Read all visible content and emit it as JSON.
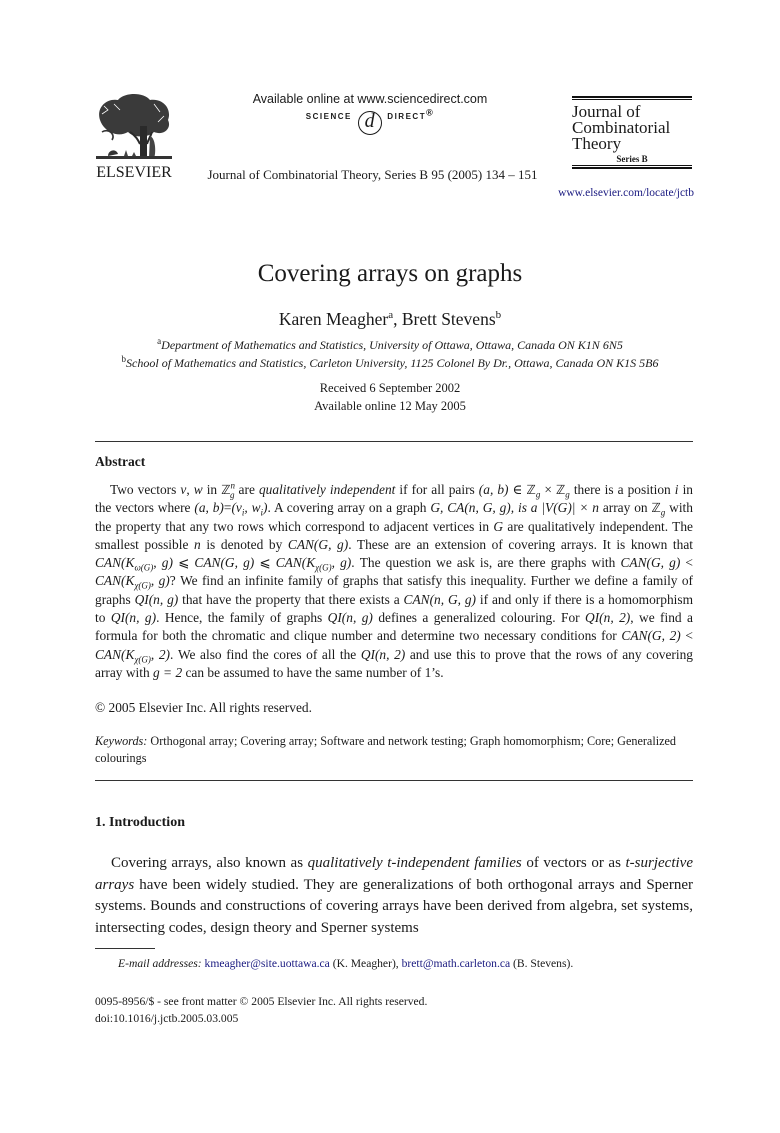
{
  "header": {
    "publisher": "ELSEVIER",
    "sciencedirect_available": "Available online at www.sciencedirect.com",
    "sciencedirect_logo_left": "SCIENCE",
    "sciencedirect_logo_at": "d",
    "sciencedirect_logo_right": "DIRECT",
    "sciencedirect_logo_mark": "®",
    "journal_citation": "Journal of Combinatorial Theory, Series B 95 (2005) 134 – 151",
    "journal_box": {
      "line1": "Journal of",
      "line2": "Combinatorial",
      "line3": "Theory",
      "series": "Series B"
    },
    "journal_url": "www.elsevier.com/locate/jctb"
  },
  "article": {
    "title": "Covering arrays on graphs",
    "authors": [
      {
        "name": "Karen Meagher",
        "mark": "a"
      },
      {
        "name": "Brett Stevens",
        "mark": "b"
      }
    ],
    "author_separator": ", ",
    "affiliations": [
      {
        "mark": "a",
        "text": "Department of Mathematics and Statistics, University of Ottawa, Ottawa, Canada ON K1N 6N5"
      },
      {
        "mark": "b",
        "text": "School of Mathematics and Statistics, Carleton University, 1125 Colonel By Dr., Ottawa, Canada ON K1S 5B6"
      }
    ],
    "received": "Received 6 September 2002",
    "available_online": "Available online 12 May 2005"
  },
  "abstract": {
    "heading": "Abstract",
    "segments": {
      "s1": "Two vectors ",
      "v": "v",
      "comma_w": ", ",
      "w": "w",
      "in": " in ",
      "Z": "ℤ",
      "g": "g",
      "n": "n",
      "are": " are ",
      "qi": "qualitatively independent",
      "iffor": " if for all pairs ",
      "ab": "(a, b)",
      "elem": " ∈ ",
      "times": " × ",
      "there": " there is a position ",
      "i": "i",
      "where": " in the vectors where ",
      "eq": "=",
      "viwi_open": "(v",
      "sub_i": "i",
      "viwi_mid": ", w",
      "viwi_close": ")",
      "acover": ". A covering array on a graph ",
      "G": "G",
      "ca": ", CA(n, G, g)",
      "isa": ", is a |V(G)| × n",
      "arrayon": " array on ",
      "prop": " with the property that any two rows which correspond to adjacent vertices in ",
      "arequal": " are qualitatively independent. The smallest possible ",
      "denoted": " is denoted by ",
      "cangg": "CAN(G, g)",
      "ext": ". These are an extension of covering arrays. It is known that ",
      "canK": "CAN(K",
      "omega": "ω(G)",
      "chi": "χ(G)",
      "comma_g": ", g)",
      "leq": " ⩽ ",
      "question": ". The question we ask is, are there graphs with ",
      "lt": " < ",
      "qmark": "? We find an infinite family of graphs that satisfy this inequality. Further we define a family of graphs ",
      "qing": "QI(n, g)",
      "haveprop": " that have the property that there exists a ",
      "canngg": "CAN(n, G, g)",
      "iff": " if and only if there is a homomorphism to ",
      "hence": ". Hence, the family of graphs ",
      "defines": " defines a generalized colouring. For ",
      "qin2": "QI(n, 2)",
      "formula": ", we find a formula for both the chromatic and clique number and determine two necessary conditions for ",
      "can2": "CAN(G, 2)",
      "comma_2": ", 2)",
      "also": ". We also find the cores of all the ",
      "use": " and use this to prove that the rows of any covering array with ",
      "g2": "g = 2",
      "same": " can be assumed to have the same number of 1’s."
    },
    "copyright": "© 2005 Elsevier Inc. All rights reserved."
  },
  "keywords": {
    "label": "Keywords:",
    "text": " Orthogonal array; Covering array; Software and network testing; Graph homomorphism; Core; Generalized colourings"
  },
  "introduction": {
    "heading": "1.  Introduction",
    "p1": "Covering arrays, also known as ",
    "p1_it1": "qualitatively t-independent families",
    "p2": " of vectors or as ",
    "p2_it2": "t-surjective arrays",
    "p3": " have been widely studied. They are generalizations of both orthogonal arrays and Sperner systems. Bounds and constructions of covering arrays have been derived from algebra, set systems, intersecting codes, design theory and Sperner systems"
  },
  "footnotes": {
    "email_label": "E-mail addresses:",
    "email1": "kmeagher@site.uottawa.ca",
    "email1_owner": " (K. Meagher), ",
    "email2": "brett@math.carleton.ca",
    "email2_owner": " (B. Stevens).",
    "issn_line": "0095-8956/$ - see front matter © 2005 Elsevier Inc. All rights reserved.",
    "doi": "doi:10.1016/j.jctb.2005.03.005"
  },
  "colors": {
    "link": "#1a1a80",
    "text": "#1a1a1a"
  }
}
